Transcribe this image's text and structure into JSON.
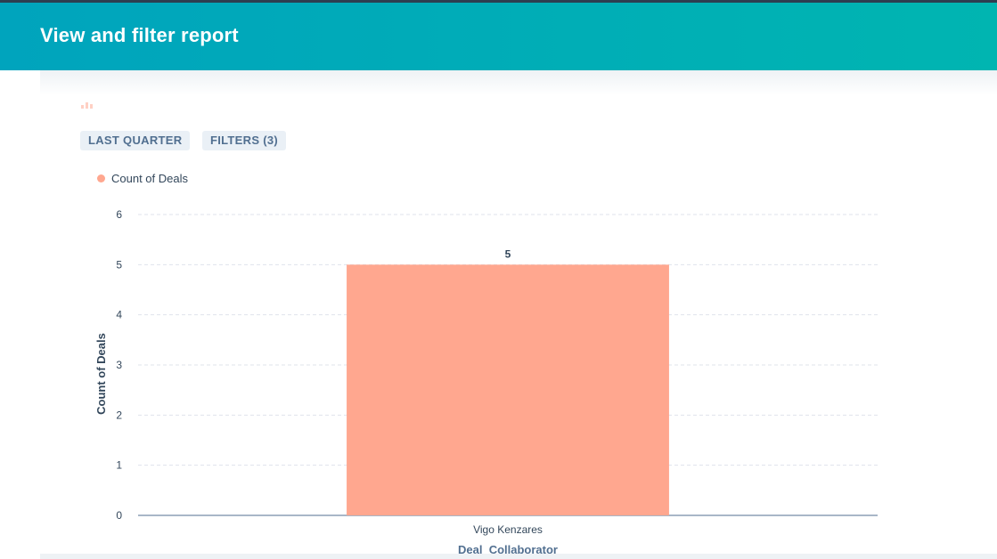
{
  "header": {
    "title": "View and filter report"
  },
  "toolbar": {
    "date_filter_label": "LAST QUARTER",
    "filters_label": "FILTERS (3)"
  },
  "colors": {
    "header_start": "#00a4bd",
    "header_end": "#00b5b1",
    "bar": "#ffa78f",
    "button_bg": "#eaf0f6"
  },
  "chart_data": {
    "type": "bar",
    "categories": [
      "Vigo Kenzares"
    ],
    "series": [
      {
        "name": "Count of Deals",
        "values": [
          5
        ]
      }
    ],
    "xlabel": "Deal_Collaborator",
    "ylabel": "Count of Deals",
    "ylim": [
      0,
      6
    ],
    "yticks": [
      0,
      1,
      2,
      3,
      4,
      5,
      6
    ],
    "data_labels": [
      "5"
    ],
    "grid": true,
    "legend_position": "top-left"
  }
}
